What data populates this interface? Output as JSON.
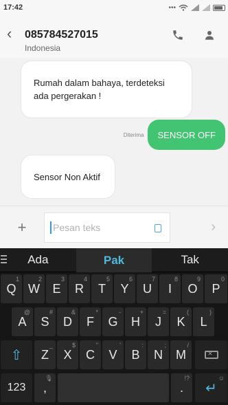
{
  "status_bar": {
    "time": "17:42",
    "icons": [
      "more-icon",
      "wifi-icon",
      "signal-icon",
      "signal-icon",
      "battery-icon"
    ]
  },
  "header": {
    "back_icon": "chevron-left-icon",
    "title": "085784527015",
    "subtitle": "Indonesia",
    "call_icon": "phone-icon",
    "contact_icon": "person-icon"
  },
  "messages": [
    {
      "direction": "incoming",
      "text": "Rumah dalam bahaya, terdeteksi ada pergerakan !"
    },
    {
      "direction": "outgoing",
      "status": "Diterima",
      "text": "SENSOR OFF"
    },
    {
      "direction": "incoming",
      "text": "Sensor Non Aktif"
    }
  ],
  "compose": {
    "attach_icon": "plus-icon",
    "placeholder": "Pesan teks",
    "sim_icon": "sim-icon",
    "send_icon": "send-icon"
  },
  "keyboard": {
    "suggestions": [
      "Ada",
      "Pak",
      "Tak"
    ],
    "accent": "#52b7dd",
    "row1": [
      {
        "key": "Q",
        "hint": "1"
      },
      {
        "key": "W",
        "hint": "2"
      },
      {
        "key": "E",
        "hint": "3"
      },
      {
        "key": "R",
        "hint": "4"
      },
      {
        "key": "T",
        "hint": "5"
      },
      {
        "key": "Y",
        "hint": "6"
      },
      {
        "key": "U",
        "hint": "7"
      },
      {
        "key": "I",
        "hint": "8"
      },
      {
        "key": "O",
        "hint": "9"
      },
      {
        "key": "P",
        "hint": "0"
      }
    ],
    "row2": [
      {
        "key": "A",
        "hint": "@"
      },
      {
        "key": "S",
        "hint": "#"
      },
      {
        "key": "D",
        "hint": "&"
      },
      {
        "key": "F",
        "hint": "*"
      },
      {
        "key": "G",
        "hint": "-"
      },
      {
        "key": "H",
        "hint": "+"
      },
      {
        "key": "J",
        "hint": "="
      },
      {
        "key": "K",
        "hint": "("
      },
      {
        "key": "L",
        "hint": ")"
      }
    ],
    "row3": [
      {
        "key": "Z",
        "hint": "_"
      },
      {
        "key": "X",
        "hint": "$"
      },
      {
        "key": "C",
        "hint": "\""
      },
      {
        "key": "V",
        "hint": "'"
      },
      {
        "key": "B",
        "hint": ":"
      },
      {
        "key": "N",
        "hint": ";"
      },
      {
        "key": "M",
        "hint": "/"
      }
    ],
    "shift_icon": "shift-icon",
    "backspace_icon": "backspace-icon",
    "numbers_label": "123",
    "comma_label": ",",
    "comma_hint": "mic-icon",
    "period_label": ".",
    "period_hint": "!?",
    "enter_icon": "enter-icon",
    "enter_hint": "emoji-icon"
  }
}
